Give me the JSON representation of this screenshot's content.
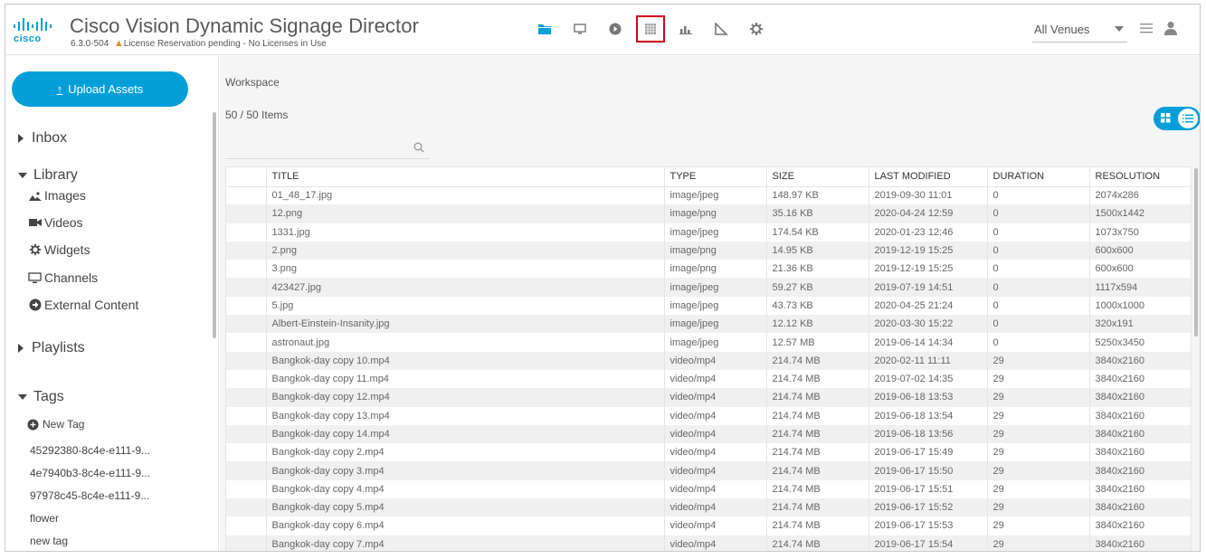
{
  "app": {
    "title": "Cisco Vision Dynamic Signage Director",
    "version": "6.3.0-504",
    "warning_symbol": "▲",
    "license_status": "License Reservation pending - No Licenses in Use",
    "brand_color": "#049fd9"
  },
  "header": {
    "nav_icons": [
      "folder-icon",
      "monitor-icon",
      "play-icon",
      "calendar-grid-icon",
      "bar-chart-icon",
      "triangle-ruler-icon",
      "gear-icon"
    ],
    "active_icon": "calendar-grid-icon",
    "venue_select": "All Venues"
  },
  "sidebar": {
    "upload_label": "Upload Assets",
    "upload_glyph": "↑",
    "inbox": "Inbox",
    "library": "Library",
    "library_items": [
      "Images",
      "Videos",
      "Widgets",
      "Channels",
      "External Content"
    ],
    "playlists": "Playlists",
    "tags": "Tags",
    "new_tag": "New Tag",
    "tag_list": [
      "45292380-8c4e-e111-9...",
      "4e7940b3-8c4e-e111-9...",
      "97978c45-8c4e-e111-9...",
      "flower",
      "new tag"
    ]
  },
  "main": {
    "breadcrumb": "Workspace",
    "items_count": "50 / 50 Items",
    "search_placeholder": "",
    "columns": [
      "TITLE",
      "TYPE",
      "SIZE",
      "LAST MODIFIED",
      "DURATION",
      "RESOLUTION"
    ],
    "rows": [
      [
        "01_48_17.jpg",
        "image/jpeg",
        "148.97 KB",
        "2019-09-30 11:01",
        "0",
        "2074x286"
      ],
      [
        "12.png",
        "image/png",
        "35.16 KB",
        "2020-04-24 12:59",
        "0",
        "1500x1442"
      ],
      [
        "1331.jpg",
        "image/jpeg",
        "174.54 KB",
        "2020-01-23 12:46",
        "0",
        "1073x750"
      ],
      [
        "2.png",
        "image/png",
        "14.95 KB",
        "2019-12-19 15:25",
        "0",
        "600x600"
      ],
      [
        "3.png",
        "image/png",
        "21.36 KB",
        "2019-12-19 15:25",
        "0",
        "600x600"
      ],
      [
        "423427.jpg",
        "image/jpeg",
        "59.27 KB",
        "2019-07-19 14:51",
        "0",
        "1117x594"
      ],
      [
        "5.jpg",
        "image/jpeg",
        "43.73 KB",
        "2020-04-25 21:24",
        "0",
        "1000x1000"
      ],
      [
        "Albert-Einstein-Insanity.jpg",
        "image/jpeg",
        "12.12 KB",
        "2020-03-30 15:22",
        "0",
        "320x191"
      ],
      [
        "astronaut.jpg",
        "image/jpeg",
        "12.57 MB",
        "2019-06-14 14:34",
        "0",
        "5250x3450"
      ],
      [
        "Bangkok-day copy 10.mp4",
        "video/mp4",
        "214.74 MB",
        "2020-02-11 11:11",
        "29",
        "3840x2160"
      ],
      [
        "Bangkok-day copy 11.mp4",
        "video/mp4",
        "214.74 MB",
        "2019-07-02 14:35",
        "29",
        "3840x2160"
      ],
      [
        "Bangkok-day copy 12.mp4",
        "video/mp4",
        "214.74 MB",
        "2019-06-18 13:53",
        "29",
        "3840x2160"
      ],
      [
        "Bangkok-day copy 13.mp4",
        "video/mp4",
        "214.74 MB",
        "2019-06-18 13:54",
        "29",
        "3840x2160"
      ],
      [
        "Bangkok-day copy 14.mp4",
        "video/mp4",
        "214.74 MB",
        "2019-06-18 13:56",
        "29",
        "3840x2160"
      ],
      [
        "Bangkok-day copy 2.mp4",
        "video/mp4",
        "214.74 MB",
        "2019-06-17 15:49",
        "29",
        "3840x2160"
      ],
      [
        "Bangkok-day copy 3.mp4",
        "video/mp4",
        "214.74 MB",
        "2019-06-17 15:50",
        "29",
        "3840x2160"
      ],
      [
        "Bangkok-day copy 4.mp4",
        "video/mp4",
        "214.74 MB",
        "2019-06-17 15:51",
        "29",
        "3840x2160"
      ],
      [
        "Bangkok-day copy 5.mp4",
        "video/mp4",
        "214.74 MB",
        "2019-06-17 15:52",
        "29",
        "3840x2160"
      ],
      [
        "Bangkok-day copy 6.mp4",
        "video/mp4",
        "214.74 MB",
        "2019-06-17 15:53",
        "29",
        "3840x2160"
      ],
      [
        "Bangkok-day copy 7.mp4",
        "video/mp4",
        "214.74 MB",
        "2019-06-17 15:54",
        "29",
        "3840x2160"
      ]
    ]
  }
}
